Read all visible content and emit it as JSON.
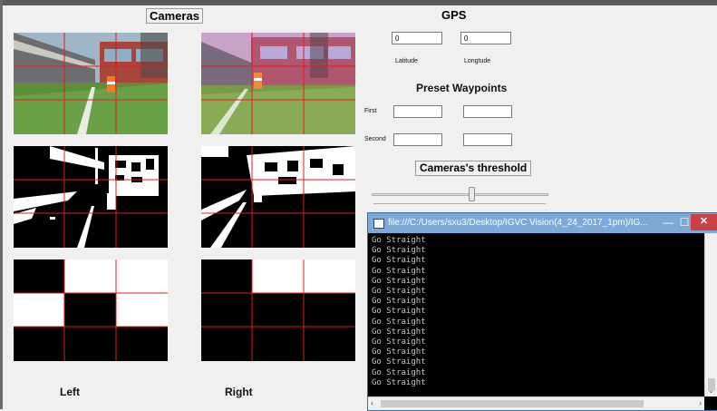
{
  "cameras": {
    "title": "Cameras",
    "left_label": "Left",
    "right_label": "Right"
  },
  "gps": {
    "title": "GPS",
    "latitude_value": "0",
    "longitude_value": "0",
    "latitude_label": "Latitude",
    "longitude_label": "Longtude"
  },
  "waypoints": {
    "title": "Preset Waypoints",
    "first_label": "First",
    "second_label": "Second",
    "first_values": [
      "",
      ""
    ],
    "second_values": [
      "",
      ""
    ]
  },
  "threshold": {
    "title": "Cameras's threshold",
    "slider_level": 0.57
  },
  "console": {
    "title": "file:///C:/Users/sxu3/Desktop/IGVC Vision(4_24_2017_1pm)/IG...",
    "lines": [
      "Go Straight",
      "Go Straight",
      "Go Straight",
      "Go Straight",
      "Go Straight",
      "Go Straight",
      "Go Straight",
      "Go Straight",
      "Go Straight",
      "Go Straight",
      "Go Straight",
      "Go Straight",
      "Go Straight",
      "Go Straight",
      "Go Straight"
    ]
  },
  "colors": {
    "grid_line": "#e31c1c",
    "console_title_bar": "#7ea8d6",
    "close_button": "#c94141"
  }
}
